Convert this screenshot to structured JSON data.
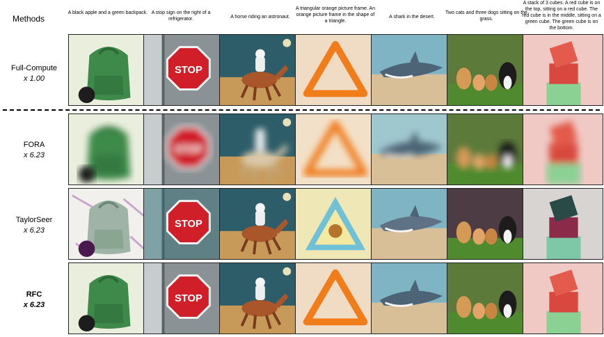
{
  "header": {
    "methods_label": "Methods"
  },
  "prompts": [
    "A black apple and a green backpack.",
    "A stop sign on the right of a refrigerator.",
    "A horse riding an astronaut.",
    "A triangular orange picture frame. An orange picture frame in the shape of a triangle.",
    "A shark in the desert.",
    "Two cats and three dogs sitting on the grass.",
    "A stack of 3 cubes. A red cube is on the top, sitting on a red cube. The red cube is in the middle, sitting on a green cube. The green cube is on the bottom."
  ],
  "methods": [
    {
      "name": "Full-Compute",
      "factor": "x 1.00",
      "style": "clean"
    },
    {
      "name": "FORA",
      "factor": "x 6.23",
      "style": "blurry"
    },
    {
      "name": "TaylorSeer",
      "factor": "x 6.23",
      "style": "artifact"
    },
    {
      "name": "RFC",
      "factor": "x 6.23",
      "style": "clean"
    }
  ],
  "stop_text": "STOP"
}
